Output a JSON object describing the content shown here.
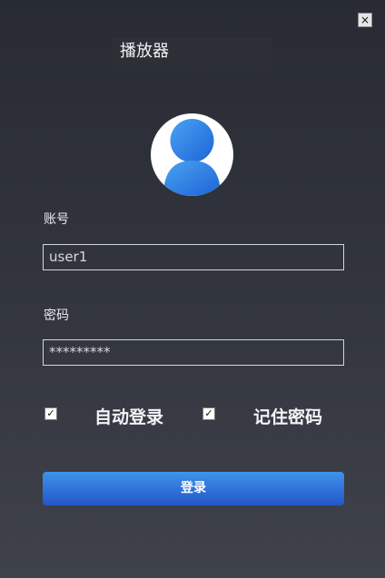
{
  "window": {
    "title": "播放器",
    "close_label": "×"
  },
  "avatar": {
    "icon": "user-avatar-icon"
  },
  "form": {
    "account_label": "账号",
    "account_value": "user1",
    "password_label": "密码",
    "password_value": "*********",
    "auto_login_label": "自动登录",
    "auto_login_checked": true,
    "remember_password_label": "记住密码",
    "remember_password_checked": true,
    "check_mark": "✓",
    "login_button_label": "登录"
  },
  "colors": {
    "accent_blue": "#2f78dd",
    "background_top": "#282b33",
    "background_bottom": "#3f424b"
  }
}
